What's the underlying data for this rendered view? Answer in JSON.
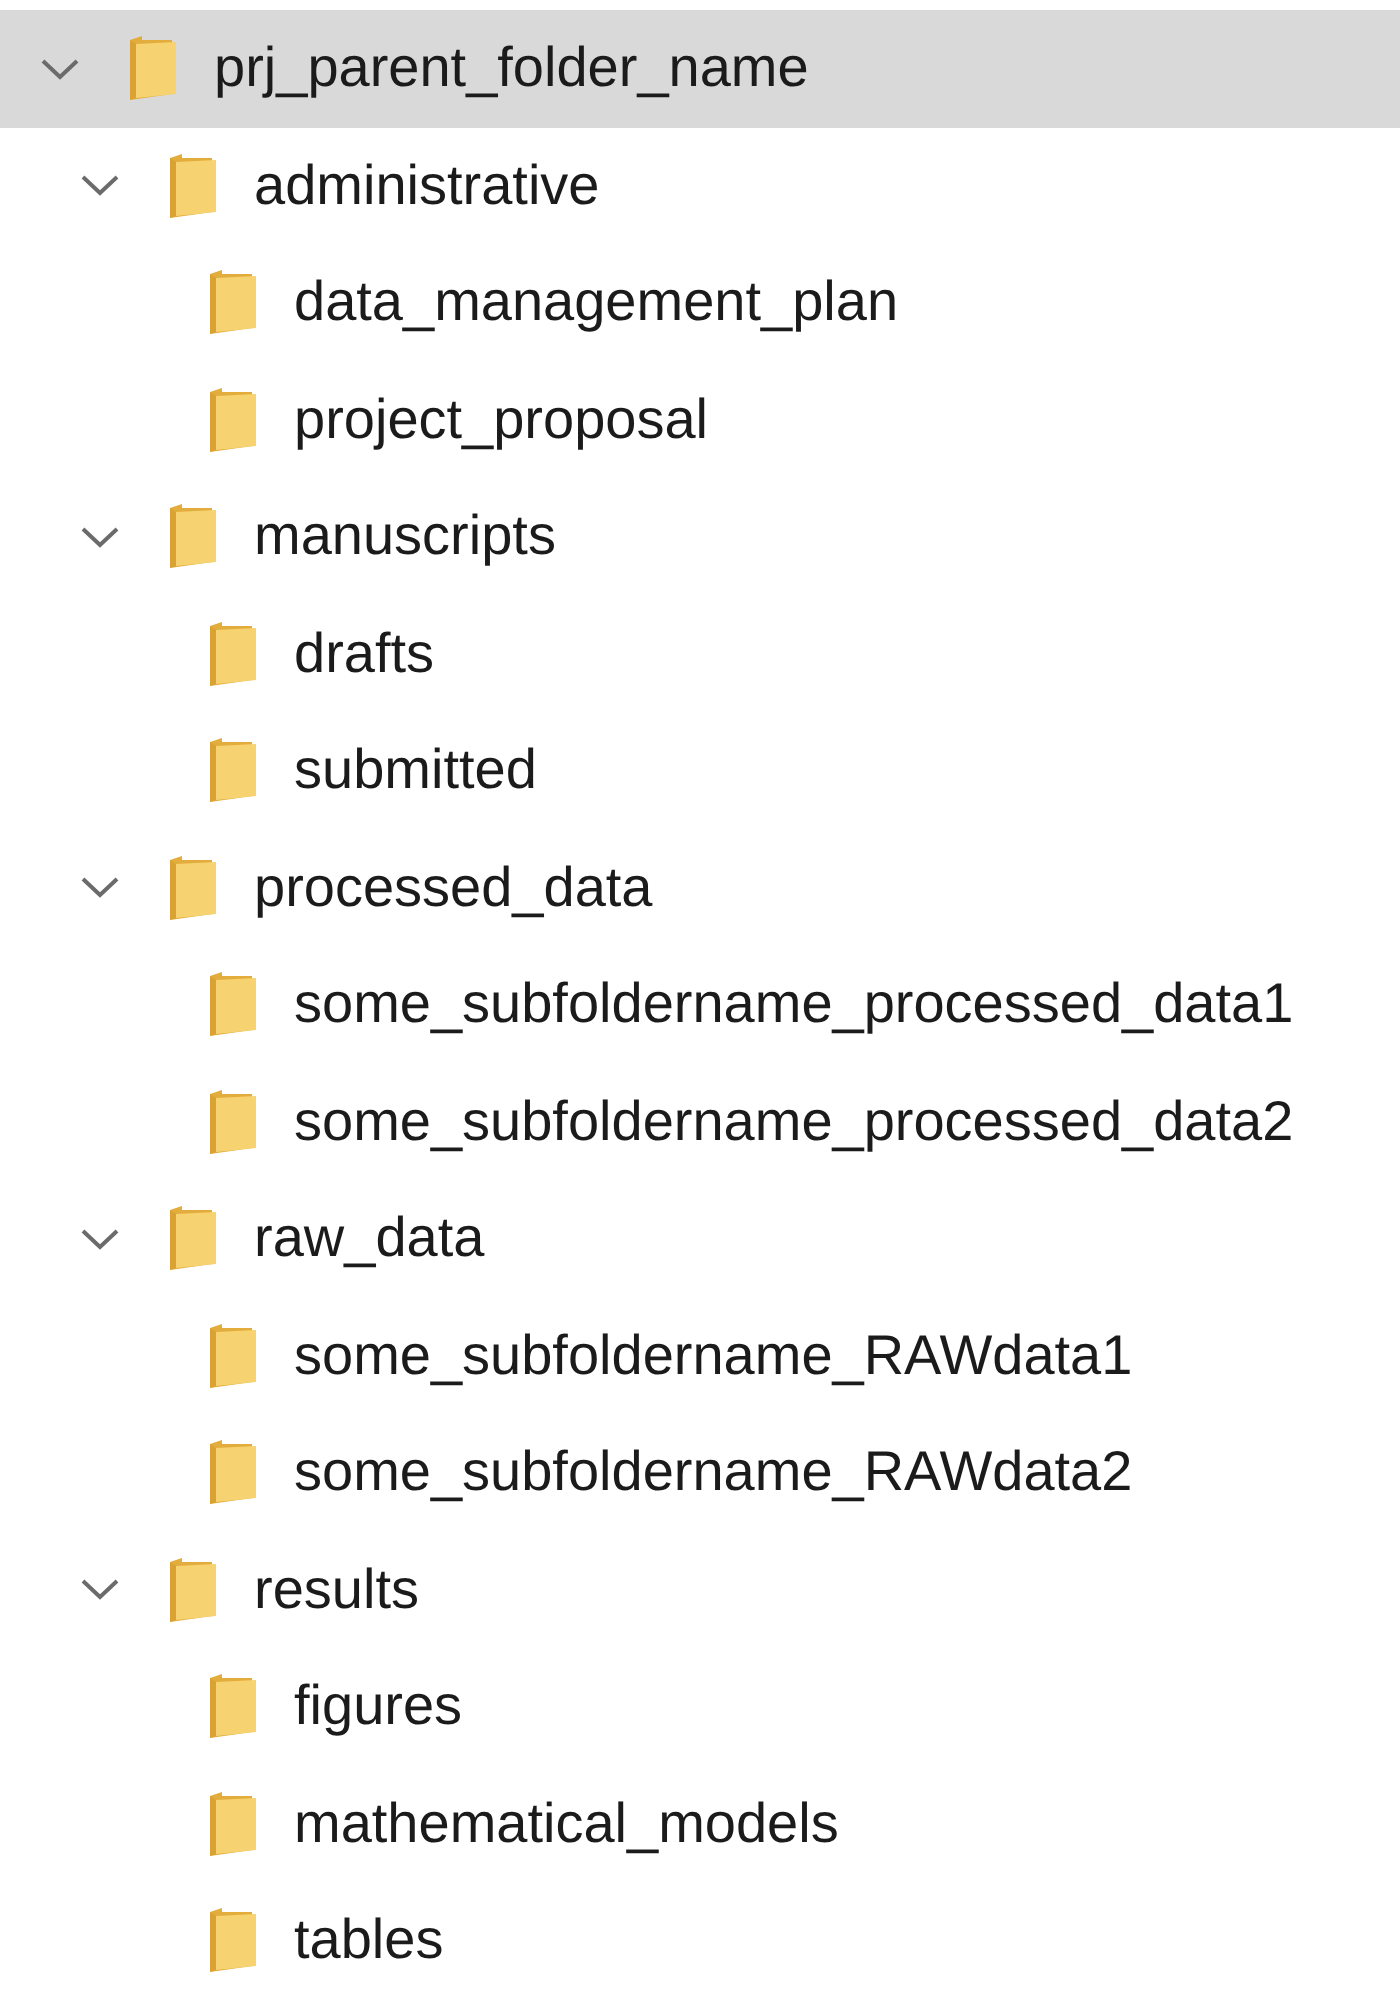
{
  "tree": [
    {
      "label": "prj_parent_folder_name",
      "expanded": true,
      "selected": true,
      "children": [
        {
          "label": "administrative",
          "expanded": true,
          "selected": false,
          "children": [
            {
              "label": "data_management_plan",
              "selected": false
            },
            {
              "label": "project_proposal",
              "selected": false
            }
          ]
        },
        {
          "label": "manuscripts",
          "expanded": true,
          "selected": false,
          "children": [
            {
              "label": "drafts",
              "selected": false
            },
            {
              "label": "submitted",
              "selected": false
            }
          ]
        },
        {
          "label": "processed_data",
          "expanded": true,
          "selected": false,
          "children": [
            {
              "label": "some_subfoldername_processed_data1",
              "selected": false
            },
            {
              "label": "some_subfoldername_processed_data2",
              "selected": false
            }
          ]
        },
        {
          "label": "raw_data",
          "expanded": true,
          "selected": false,
          "children": [
            {
              "label": "some_subfoldername_RAWdata1",
              "selected": false
            },
            {
              "label": "some_subfoldername_RAWdata2",
              "selected": false
            }
          ]
        },
        {
          "label": "results",
          "expanded": true,
          "selected": false,
          "children": [
            {
              "label": "figures",
              "selected": false
            },
            {
              "label": "mathematical_models",
              "selected": false
            },
            {
              "label": "tables",
              "selected": false
            }
          ]
        }
      ]
    }
  ]
}
